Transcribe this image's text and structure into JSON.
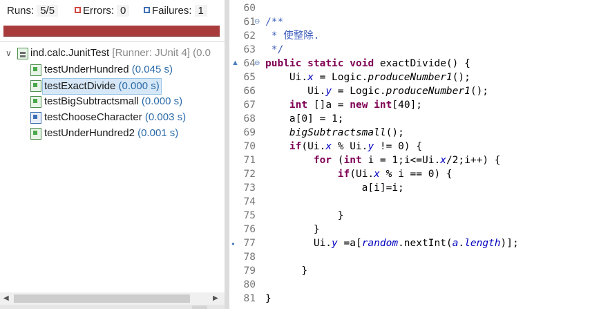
{
  "junit": {
    "runs_label": "Runs:",
    "runs_value": "5/5",
    "errors_label": "Errors:",
    "errors_value": "0",
    "failures_label": "Failures:",
    "failures_value": "1",
    "progress_fraction": 1.0,
    "colors": {
      "progress_bar": "#a83c3c",
      "selection": "#d6e8f7",
      "time": "#2b6aa8"
    },
    "suite": {
      "name": "ind.calc.JunitTest",
      "runner": "[Runner: JUnit 4] (0.0"
    },
    "tests": [
      {
        "name": "testUnderHundred",
        "time": "(0.045 s)",
        "status": "pass"
      },
      {
        "name": "testExactDivide",
        "time": "(0.000 s)",
        "status": "pass",
        "selected": true
      },
      {
        "name": "testBigSubtractsmall",
        "time": "(0.000 s)",
        "status": "pass"
      },
      {
        "name": "testChooseCharacter",
        "time": "(0.003 s)",
        "status": "fail"
      },
      {
        "name": "testUnderHundred2",
        "time": "(0.001 s)",
        "status": "pass"
      }
    ]
  },
  "editor": {
    "lines": [
      {
        "n": "60",
        "code": ""
      },
      {
        "n": "61",
        "code": "/**"
      },
      {
        "n": "62",
        "code": " * 使整除."
      },
      {
        "n": "63",
        "code": " */"
      },
      {
        "n": "64",
        "code": "public static void exactDivide() {"
      },
      {
        "n": "65",
        "code": "    Ui.x = Logic.produceNumber1();"
      },
      {
        "n": "66",
        "code": "       Ui.y = Logic.produceNumber1();"
      },
      {
        "n": "67",
        "code": "    int []a = new int[40];"
      },
      {
        "n": "68",
        "code": "    a[0] = 1;"
      },
      {
        "n": "69",
        "code": "    bigSubtractsmall();"
      },
      {
        "n": "70",
        "code": "    if(Ui.x % Ui.y != 0) {"
      },
      {
        "n": "71",
        "code": "        for (int i = 1;i<=Ui.x/2;i++) {"
      },
      {
        "n": "72",
        "code": "            if(Ui.x % i == 0) {"
      },
      {
        "n": "73",
        "code": "                a[i]=i;"
      },
      {
        "n": "74",
        "code": ""
      },
      {
        "n": "75",
        "code": "            }"
      },
      {
        "n": "76",
        "code": "        }"
      },
      {
        "n": "77",
        "code": "        Ui.y =a[random.nextInt(a.length)];"
      },
      {
        "n": "78",
        "code": ""
      },
      {
        "n": "79",
        "code": "      }"
      },
      {
        "n": "80",
        "code": ""
      },
      {
        "n": "81",
        "code": "}"
      }
    ]
  }
}
